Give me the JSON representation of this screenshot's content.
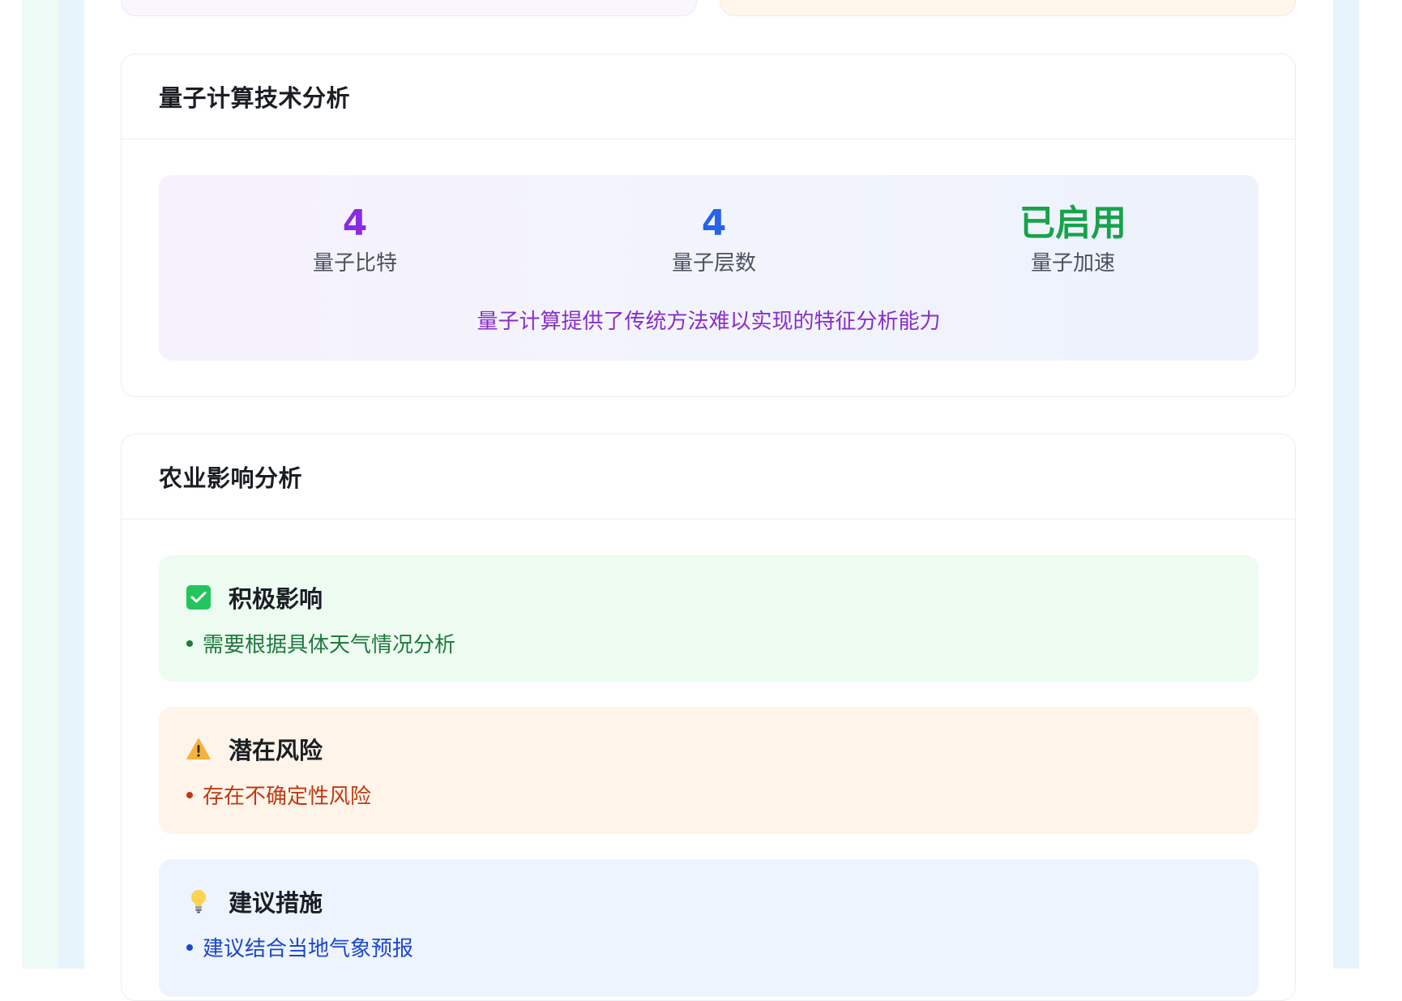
{
  "quantum_section": {
    "title": "量子计算技术分析",
    "stats": [
      {
        "value": "4",
        "label": "量子比特",
        "color": "#8a2be2"
      },
      {
        "value": "4",
        "label": "量子层数",
        "color": "#2563eb"
      },
      {
        "value": "已启用",
        "label": "量子加速",
        "color": "#16a34a"
      }
    ],
    "note": "量子计算提供了传统方法难以实现的特征分析能力"
  },
  "agri_section": {
    "title": "农业影响分析",
    "positive": {
      "icon": "check-box-icon",
      "title": "积极影响",
      "items": [
        "需要根据具体天气情况分析"
      ]
    },
    "risk": {
      "icon": "warning-icon",
      "title": "潜在风险",
      "items": [
        "存在不确定性风险"
      ]
    },
    "suggestion": {
      "icon": "lightbulb-icon",
      "title": "建议措施",
      "items": [
        "建议结合当地气象预报"
      ]
    }
  },
  "colors": {
    "positive_bg": "#edfbf1",
    "risk_bg": "#fff4ea",
    "suggestion_bg": "#edf4fe",
    "quantum_note": "#8a2ec9"
  }
}
